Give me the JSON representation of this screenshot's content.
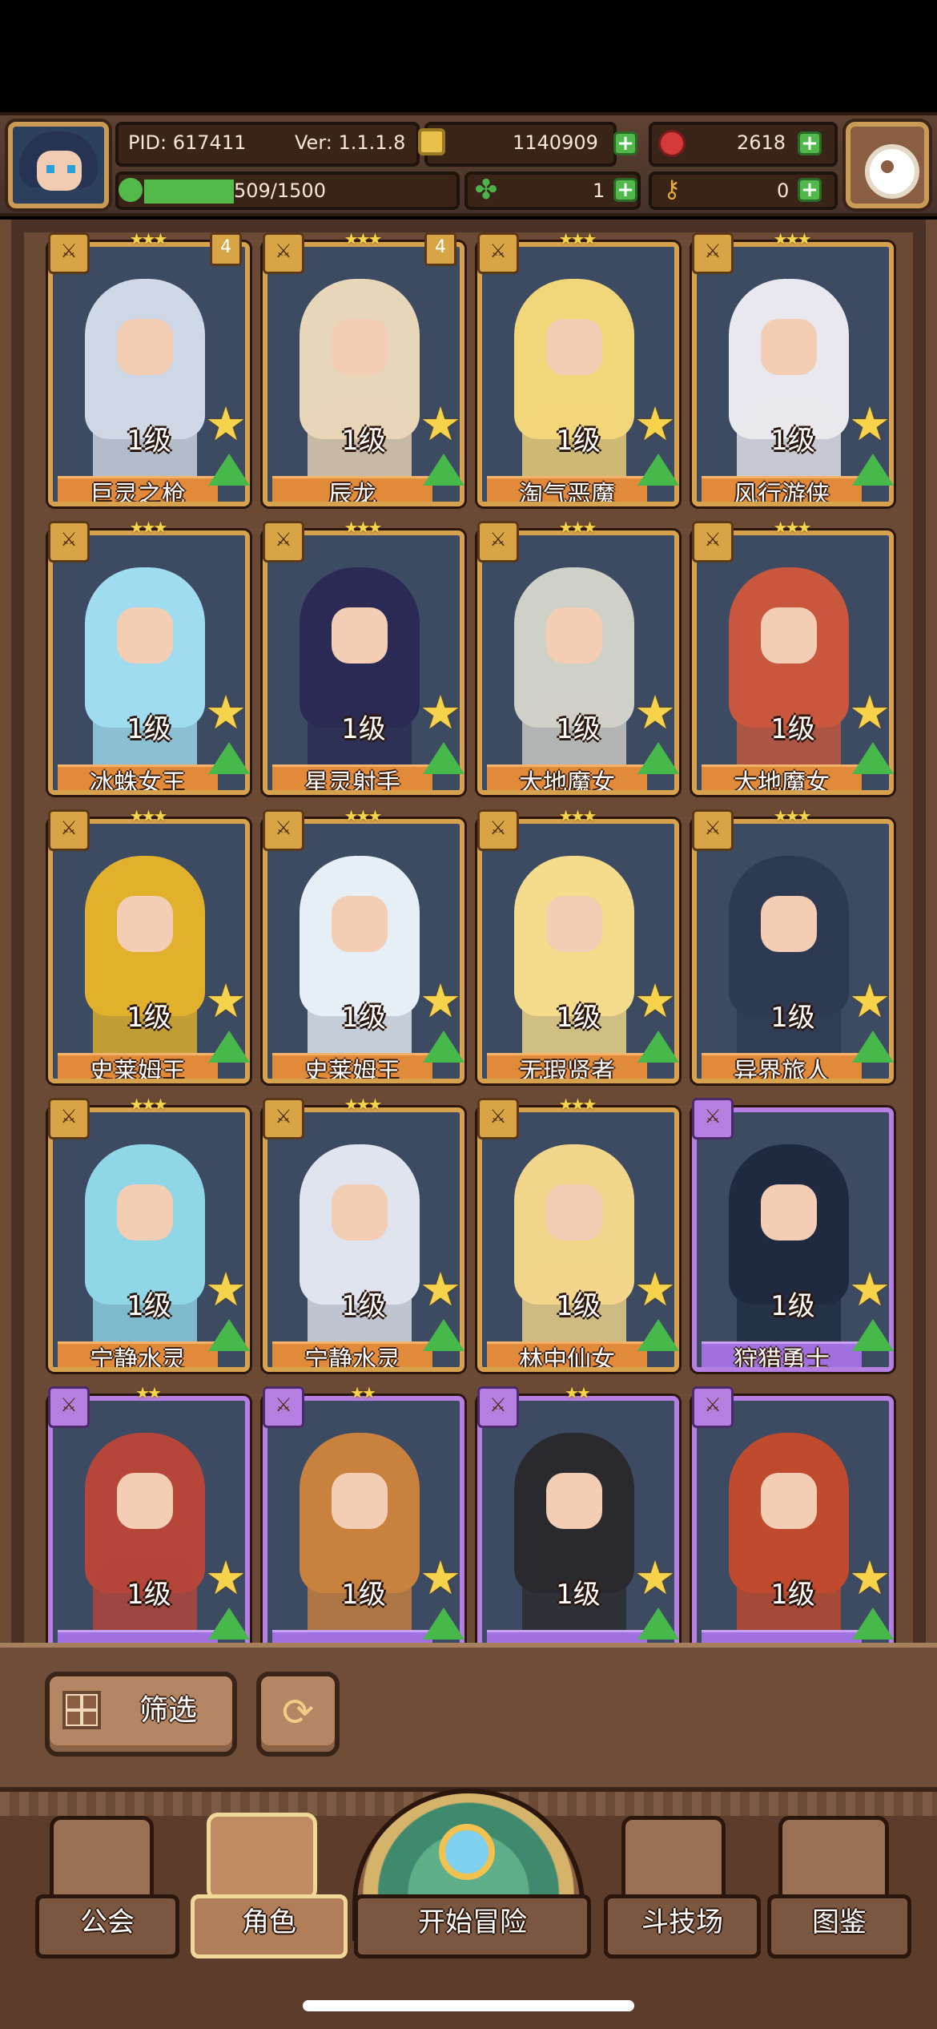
{
  "header": {
    "pid": "PID: 617411",
    "version": "Ver: 1.1.1.8",
    "xp": "509/1500",
    "xp_fraction": 0.339,
    "gold": "1140909",
    "ruby": "2618",
    "clover": "1",
    "key": "0"
  },
  "cards": [
    {
      "name": "巨灵之枪",
      "level": "1级",
      "stars": "★★★",
      "badge": "4",
      "color": "gold",
      "tint": "#cfd8e6"
    },
    {
      "name": "辰龙",
      "level": "1级",
      "stars": "★★★",
      "badge": "4",
      "color": "gold",
      "tint": "#e8d6b8"
    },
    {
      "name": "淘气恶魔",
      "level": "1级",
      "stars": "★★★",
      "badge": "",
      "color": "gold",
      "tint": "#f2d67a"
    },
    {
      "name": "风行游侠",
      "level": "1级",
      "stars": "★★★",
      "badge": "",
      "color": "gold",
      "tint": "#e8e8ee"
    },
    {
      "name": "冰蛛女王",
      "level": "1级",
      "stars": "★★★",
      "badge": "",
      "color": "gold",
      "tint": "#9fdcef"
    },
    {
      "name": "星灵射手",
      "level": "1级",
      "stars": "★★★",
      "badge": "",
      "color": "gold",
      "tint": "#2a2a54"
    },
    {
      "name": "大地魔女",
      "level": "1级",
      "stars": "★★★",
      "badge": "",
      "color": "gold",
      "tint": "#cfd0c8"
    },
    {
      "name": "大地魔女",
      "level": "1级",
      "stars": "★★★",
      "badge": "",
      "color": "gold",
      "tint": "#c9573e"
    },
    {
      "name": "史莱姆王",
      "level": "1级",
      "stars": "★★★",
      "badge": "",
      "color": "gold",
      "tint": "#e2b12c"
    },
    {
      "name": "史莱姆王",
      "level": "1级",
      "stars": "★★★",
      "badge": "",
      "color": "gold",
      "tint": "#e6eef6"
    },
    {
      "name": "无瑕贤者",
      "level": "1级",
      "stars": "★★★",
      "badge": "",
      "color": "gold",
      "tint": "#f4dc8c"
    },
    {
      "name": "异界旅人",
      "level": "1级",
      "stars": "★★★",
      "badge": "",
      "color": "gold",
      "tint": "#2e3a52"
    },
    {
      "name": "宁静水灵",
      "level": "1级",
      "stars": "★★★",
      "badge": "",
      "color": "gold",
      "tint": "#8fd6e6"
    },
    {
      "name": "宁静水灵",
      "level": "1级",
      "stars": "★★★",
      "badge": "",
      "color": "gold",
      "tint": "#dfe4ee"
    },
    {
      "name": "林中仙女",
      "level": "1级",
      "stars": "★★★",
      "badge": "",
      "color": "gold",
      "tint": "#f2d68c"
    },
    {
      "name": "狩猎勇士",
      "level": "1级",
      "stars": "",
      "badge": "",
      "color": "purple",
      "tint": "#1f2a40"
    },
    {
      "name": "",
      "level": "1级",
      "stars": "★★",
      "badge": "",
      "color": "purple",
      "tint": "#b6453a"
    },
    {
      "name": "",
      "level": "1级",
      "stars": "★★",
      "badge": "",
      "color": "purple",
      "tint": "#c9813e"
    },
    {
      "name": "",
      "level": "1级",
      "stars": "★★",
      "badge": "",
      "color": "purple",
      "tint": "#2a2a2e"
    },
    {
      "name": "",
      "level": "1级",
      "stars": "",
      "badge": "",
      "color": "purple",
      "tint": "#c04a2e"
    }
  ],
  "filter": {
    "label": "筛选"
  },
  "nav": {
    "guild": "公会",
    "character": "角色",
    "adventure": "开始冒险",
    "arena": "斗技场",
    "codex": "图鉴"
  }
}
